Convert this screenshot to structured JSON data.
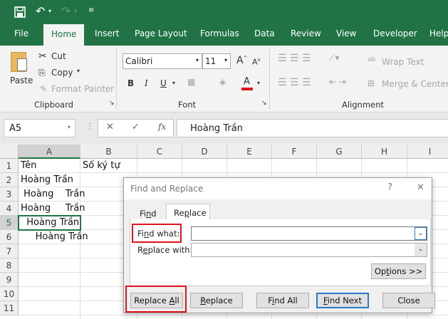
{
  "quick_access": {
    "icons": [
      "save-icon",
      "undo-icon",
      "redo-icon",
      "customize-icon"
    ]
  },
  "tabs": [
    "File",
    "Home",
    "Insert",
    "Page Layout",
    "Formulas",
    "Data",
    "Review",
    "View",
    "Developer",
    "Help"
  ],
  "active_tab": "Home",
  "ribbon": {
    "clipboard": {
      "paste": "Paste",
      "cut": "Cut",
      "copy": "Copy",
      "format_painter": "Format Painter",
      "group": "Clipboard"
    },
    "font": {
      "name": "Calibri",
      "size": "11",
      "bold": "B",
      "italic": "I",
      "underline": "U",
      "font_color": "#e0141e",
      "group": "Font"
    },
    "alignment": {
      "wrap_text": "Wrap Text",
      "merge_center": "Merge & Center",
      "group": "Alignment"
    }
  },
  "formula_bar": {
    "name_box": "A5",
    "cancel": "✕",
    "enter": "✓",
    "fx": "fx",
    "value": "Hoàng Trần"
  },
  "columns": [
    "A",
    "B",
    "C",
    "D",
    "E",
    "F",
    "G",
    "H",
    "I"
  ],
  "rows": [
    "1",
    "2",
    "3",
    "4",
    "5",
    "6",
    "7",
    "8",
    "9",
    "10",
    "11"
  ],
  "cells": {
    "A1": "Tên",
    "B1": "Số ký tự",
    "A2": "Hoàng Trần",
    "A3": " Hoàng    Trần",
    "A4": "Hoàng     Trần",
    "A5": "  Hoàng Trần",
    "A6": "     Hoàng Trần"
  },
  "selected_cell": "A5",
  "dialog": {
    "title": "Find and Replace",
    "help": "?",
    "close": "✕",
    "tabs": [
      "Find",
      "Replace"
    ],
    "active_tab": "Replace",
    "find_what_label": "Find what:",
    "find_what_value": "",
    "replace_with_label": "Replace with:",
    "replace_with_value": "",
    "options": "Options >>",
    "buttons": [
      "Replace All",
      "Replace",
      "Find All",
      "Find Next",
      "Close"
    ]
  },
  "highlight_color": "#e0141e",
  "accent": "#217346"
}
